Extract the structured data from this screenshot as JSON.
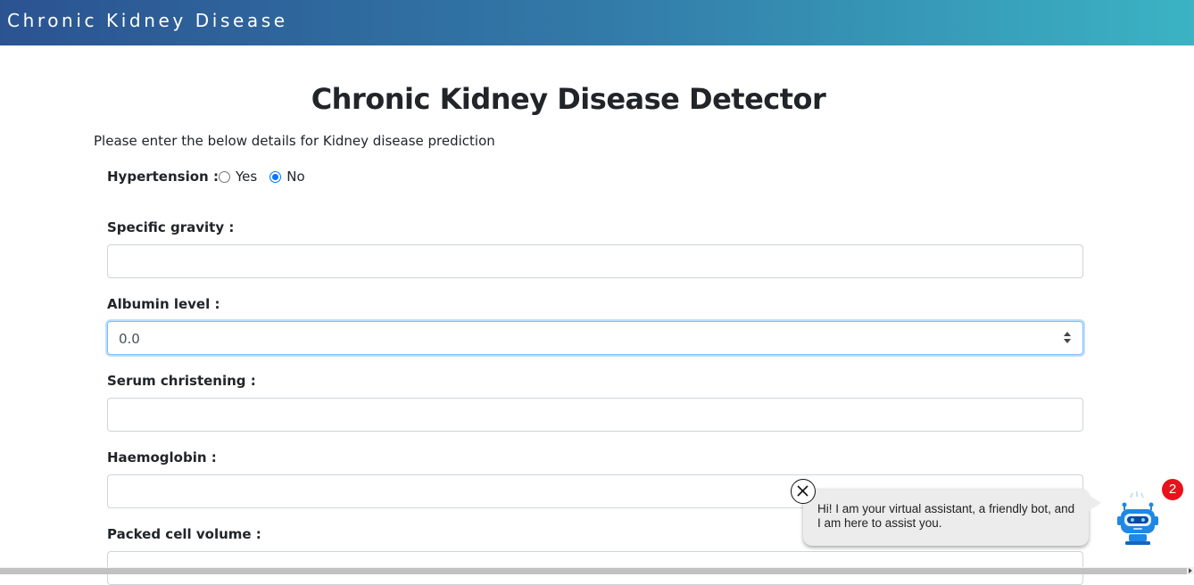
{
  "header": {
    "brand": "Chronic Kidney Disease"
  },
  "page": {
    "title": "Chronic Kidney Disease Detector",
    "intro": "Please enter the below details for Kidney disease prediction"
  },
  "form": {
    "hypertension": {
      "label": "Hypertension :",
      "options": [
        "Yes",
        "No"
      ],
      "selected": "No"
    },
    "specific_gravity": {
      "label": "Specific gravity :",
      "value": ""
    },
    "albumin": {
      "label": "Albumin level :",
      "value": "0.0"
    },
    "serum": {
      "label": "Serum christening :",
      "value": ""
    },
    "haemoglobin": {
      "label": "Haemoglobin :",
      "value": ""
    },
    "packed_cell": {
      "label": "Packed cell volume :",
      "value": ""
    }
  },
  "chatbot": {
    "message": "Hi! I am your virtual assistant, a friendly bot, and I am here to assist you.",
    "badge_count": "2",
    "icon": "robot-icon",
    "accent": "#1e88e5",
    "badge_color": "#e8121b"
  },
  "colors": {
    "header_gradient_start": "#2b5391",
    "header_gradient_end": "#3bb3c4",
    "focus_border": "#80bdff",
    "radio_checked": "#0075ff"
  }
}
